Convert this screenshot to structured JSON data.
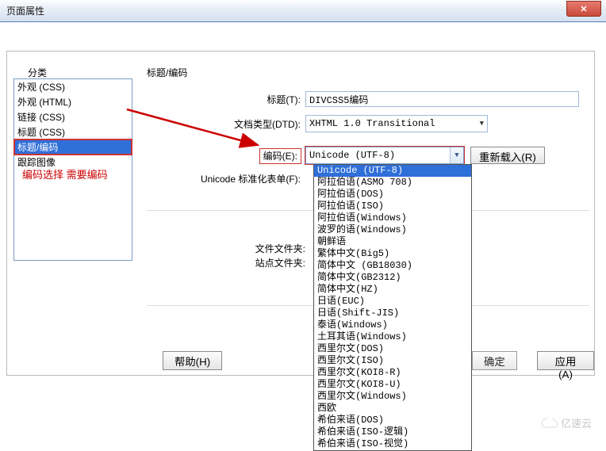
{
  "window": {
    "title": "页面属性"
  },
  "labels": {
    "category": "分类",
    "panel": "标题/编码",
    "title_field": "标题(T):",
    "dtd_field": "文档类型(DTD):",
    "encoding_field": "编码(E):",
    "normalize_field": "Unicode 标准化表单(F):",
    "file_folder": "文件文件夹:",
    "site_folder": "站点文件夹:"
  },
  "categories": [
    "外观 (CSS)",
    "外观 (HTML)",
    "链接 (CSS)",
    "标题 (CSS)",
    "标题/编码",
    "跟踪图像"
  ],
  "selected_category_index": 4,
  "fields": {
    "title_value": "DIVCSS5编码",
    "dtd_value": "XHTML 1.0 Transitional",
    "encoding_value": "Unicode (UTF-8)"
  },
  "encoding_options": [
    "Unicode (UTF-8)",
    "阿拉伯语(ASMO 708)",
    "阿拉伯语(DOS)",
    "阿拉伯语(ISO)",
    "阿拉伯语(Windows)",
    "波罗的语(Windows)",
    "朝鲜语",
    "繁体中文(Big5)",
    "简体中文 (GB18030)",
    "简体中文(GB2312)",
    "简体中文(HZ)",
    "日语(EUC)",
    "日语(Shift-JIS)",
    "泰语(Windows)",
    "土耳其语(Windows)",
    "西里尔文(DOS)",
    "西里尔文(ISO)",
    "西里尔文(KOI8-R)",
    "西里尔文(KOI8-U)",
    "西里尔文(Windows)",
    "西欧",
    "希伯来语(DOS)",
    "希伯来语(ISO-逻辑)",
    "希伯来语(ISO-视觉)"
  ],
  "encoding_selected_index": 0,
  "buttons": {
    "reload": "重新载入(R)",
    "help": "帮助(H)",
    "ok": "确定",
    "apply": "应用(A)"
  },
  "annotation": "编码选择 需要编码",
  "watermark": "亿速云"
}
